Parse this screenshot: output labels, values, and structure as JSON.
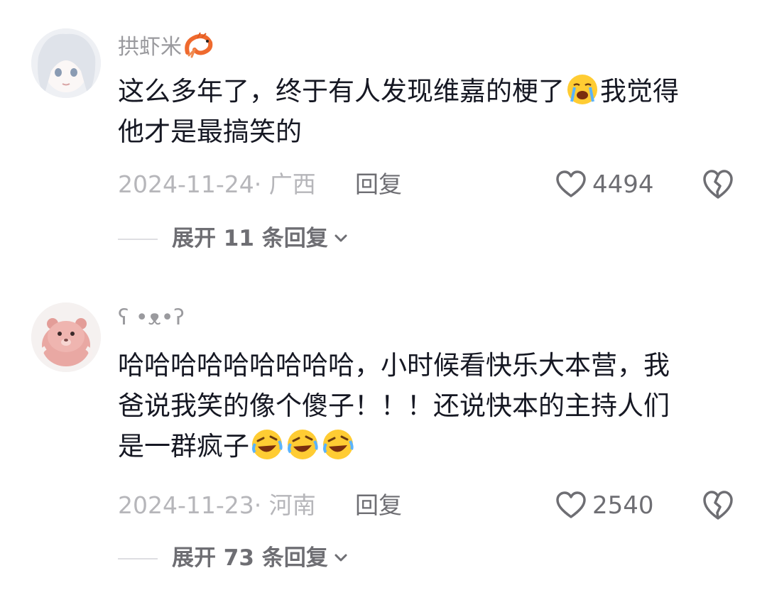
{
  "comments": [
    {
      "username": "拱虾米",
      "username_emoji": "shrimp-icon",
      "text_line1": "这么多年了，终于有人发现维嘉的梗了",
      "text_line1_tail": "我觉得",
      "text_line2": "他才是最搞笑的",
      "date_location": "2024-11-24· 广西",
      "reply_label": "回复",
      "likes": "4494",
      "expand_label": "展开 11 条回复"
    },
    {
      "username": "ʕ •ᴥ•ʔ",
      "text_line1": "哈哈哈哈哈哈哈哈哈，小时候看快乐大本营，我",
      "text_line2": "爸说我笑的像个傻子！！！还说快本的主持人们",
      "text_line3": "是一群疯子",
      "date_location": "2024-11-23· 河南",
      "reply_label": "回复",
      "likes": "2540",
      "expand_label": "展开 73 条回复"
    }
  ],
  "colors": {
    "primary_text": "#161823",
    "secondary_text": "#9a9a9e",
    "meta_text": "#b6b6ba",
    "action_text": "#6e6e73"
  }
}
